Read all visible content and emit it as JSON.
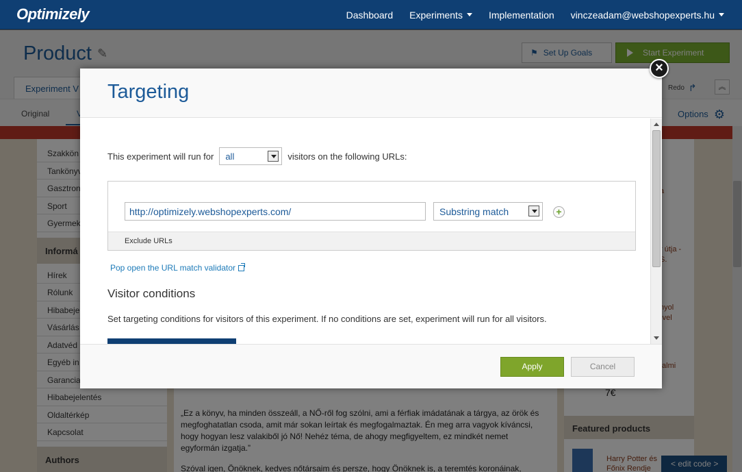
{
  "topnav": {
    "logo": "Optimizely",
    "links": [
      "Dashboard",
      "Experiments",
      "Implementation"
    ],
    "account": "vinczeadam@webshopexperts.hu"
  },
  "header": {
    "title": "Product",
    "goals_label": "Set Up Goals",
    "start_label": "Start Experiment",
    "tab_label": "Experiment V",
    "redo_label": "Redo",
    "original_label": "Original",
    "variation_label": "V",
    "options_label": "Options"
  },
  "background": {
    "categories": [
      "Szakkön",
      "Tankönyv",
      "Gasztron",
      "Sport",
      "Gyermek"
    ],
    "info_heading": "Informá",
    "info_items": [
      "Hírek",
      "Rólunk",
      "Hibabejel",
      "Vásárlás",
      "Adatvéd",
      "Egyéb in",
      "Garancia",
      "Hibabejelentés",
      "Oldaltérkép",
      "Kapcsolat"
    ],
    "authors_heading": "Authors",
    "quote": "„Ez a könyv, ha minden összeáll, a NŐ-ről fog szólni, ami a férfiak imádatának a tárgya, az örök és megfoghatatlan csoda, amit már sokan leírtak és megfogalmaztak. Én meg arra vagyok kíváncsi, hogy hogyan lesz valakiből jó Nő! Nehéz téma, de ahogy megfigyeltem, ez mindkét nemet egyformán izgatja.”",
    "quote2": "Szóval igen, Önöknek, kedves nőtársaim és persze, hogy Önöknek is, a teremtés koronáinak,",
    "right_fragments": [
      "a",
      "r útja -",
      "S.",
      "nyol",
      "-vel",
      "talmi",
      "7€"
    ],
    "featured_heading": "Featured products",
    "book_title_1": "Harry Potter és",
    "book_title_2": "Főnix Rendje",
    "edit_code": "< edit code >"
  },
  "modal": {
    "title": "Targeting",
    "close_symbol": "×",
    "run_prefix": "This experiment will run for",
    "audience_value": "all",
    "run_suffix": "visitors on the following URLs:",
    "url_value": "http://optimizely.webshopexperts.com/",
    "match_type": "Substring match",
    "add_symbol": "+",
    "exclude_label": "Exclude URLs",
    "validator_link": "Pop open the URL match validator",
    "visitor_conditions_heading": "Visitor conditions",
    "visitor_conditions_desc": "Set targeting conditions for visitors of this experiment. If no conditions are set, experiment will run for all visitors.",
    "apply_label": "Apply",
    "cancel_label": "Cancel"
  },
  "colors": {
    "nav": "#0f3f73",
    "title_blue": "#1c5a98",
    "apply_green": "#7fa52b",
    "start_green": "#7bb031",
    "alert_red": "#c0392b"
  }
}
